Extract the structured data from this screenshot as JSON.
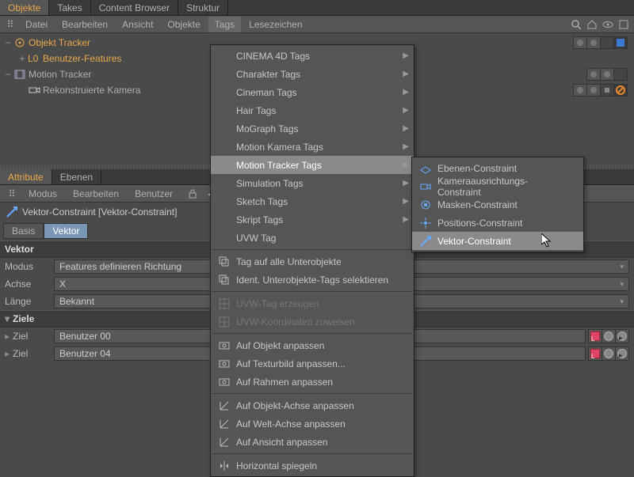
{
  "top_tabs": [
    "Objekte",
    "Takes",
    "Content Browser",
    "Struktur"
  ],
  "top_tabs_active": 0,
  "menubar": [
    "Datei",
    "Bearbeiten",
    "Ansicht",
    "Objekte",
    "Tags",
    "Lesezeichen"
  ],
  "menubar_open": 4,
  "hierarchy": [
    {
      "indent": 0,
      "expand": "−",
      "icon": "target",
      "label": "Objekt Tracker",
      "sel": true,
      "badges": [
        "vis",
        "vis",
        "blank",
        "tag-blue"
      ]
    },
    {
      "indent": 1,
      "expand": "+",
      "icon": "layers",
      "label": "Benutzer-Features",
      "sel": true,
      "badges": []
    },
    {
      "indent": 0,
      "expand": "−",
      "icon": "film",
      "label": "Motion Tracker",
      "sel": false,
      "badges": [
        "vis",
        "vis",
        "blank"
      ]
    },
    {
      "indent": 1,
      "expand": "",
      "icon": "camera",
      "label": "Rekonstruierte Kamera",
      "sel": false,
      "badges": [
        "vis",
        "vis",
        "dot",
        "no"
      ]
    }
  ],
  "attr_tabs": [
    "Attribute",
    "Ebenen"
  ],
  "attr_tabs_active": 0,
  "attr_menu": [
    "Modus",
    "Bearbeiten",
    "Benutzer"
  ],
  "attr_title": "Vektor-Constraint [Vektor-Constraint]",
  "attr_modes": [
    "Basis",
    "Vektor"
  ],
  "attr_modes_active": 1,
  "sec_vektor": "Vektor",
  "props": {
    "modus_label": "Modus",
    "modus_value": "Features definieren Richtung",
    "achse_label": "Achse",
    "achse_value": "X",
    "laenge_label": "Länge",
    "laenge_value": "Bekannt"
  },
  "sec_ziele": "Ziele",
  "ziele": [
    {
      "label": "Ziel",
      "value": "Benutzer 00"
    },
    {
      "label": "Ziel",
      "value": "Benutzer 04"
    }
  ],
  "ctx_main": [
    {
      "t": "CINEMA 4D Tags",
      "sub": true
    },
    {
      "t": "Charakter Tags",
      "sub": true
    },
    {
      "t": "Cineman Tags",
      "sub": true
    },
    {
      "t": "Hair Tags",
      "sub": true
    },
    {
      "t": "MoGraph Tags",
      "sub": true
    },
    {
      "t": "Motion Kamera Tags",
      "sub": true
    },
    {
      "t": "Motion Tracker Tags",
      "sub": true,
      "hi": true
    },
    {
      "t": "Simulation Tags",
      "sub": true
    },
    {
      "t": "Sketch Tags",
      "sub": true
    },
    {
      "t": "Skript Tags",
      "sub": true
    },
    {
      "t": "UVW Tag",
      "sub": false
    },
    {
      "sep": true
    },
    {
      "t": "Tag auf alle Unterobjekte",
      "icon": "copy"
    },
    {
      "t": "Ident. Unterobjekte-Tags selektieren",
      "icon": "copy"
    },
    {
      "sep": true
    },
    {
      "t": "UVW-Tag erzeugen",
      "disabled": true,
      "icon": "grid"
    },
    {
      "t": "UVW-Koordinaten zuweisen",
      "disabled": true,
      "icon": "grid"
    },
    {
      "sep": true
    },
    {
      "t": "Auf Objekt anpassen",
      "icon": "fit"
    },
    {
      "t": "Auf Texturbild anpassen...",
      "icon": "fit"
    },
    {
      "t": "Auf Rahmen anpassen",
      "icon": "fit"
    },
    {
      "sep": true
    },
    {
      "t": "Auf Objekt-Achse anpassen",
      "icon": "axis"
    },
    {
      "t": "Auf Welt-Achse anpassen",
      "icon": "axis"
    },
    {
      "t": "Auf Ansicht anpassen",
      "icon": "axis"
    },
    {
      "sep": true
    },
    {
      "t": "Horizontal spiegeln",
      "icon": "flip"
    }
  ],
  "ctx_sub": [
    {
      "t": "Ebenen-Constraint",
      "icon": "plane"
    },
    {
      "t": "Kameraausrichtungs-Constraint",
      "icon": "cam"
    },
    {
      "t": "Masken-Constraint",
      "icon": "mask"
    },
    {
      "t": "Positions-Constraint",
      "icon": "pos"
    },
    {
      "t": "Vektor-Constraint",
      "icon": "vec",
      "hi": true
    }
  ]
}
